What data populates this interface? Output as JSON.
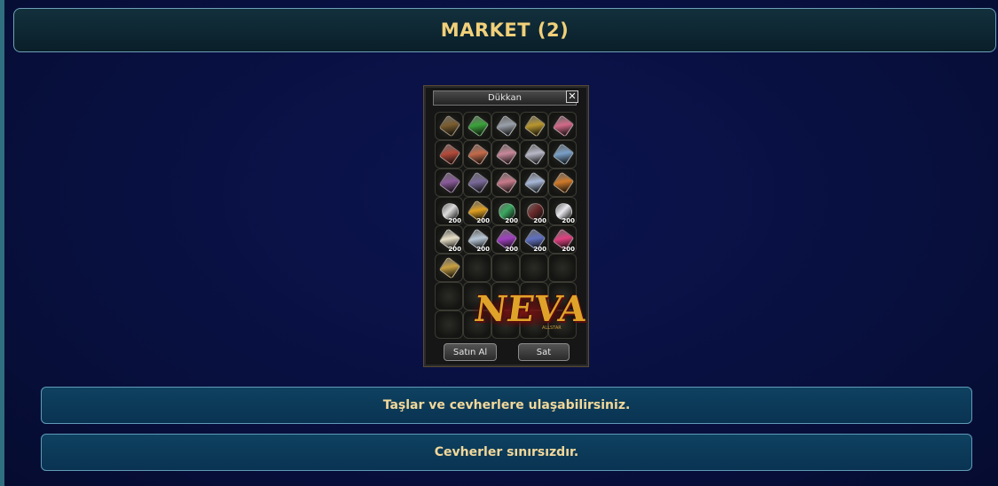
{
  "header": {
    "title": "MARKET (2)"
  },
  "shop": {
    "title": "Dükkan",
    "close_glyph": "✕",
    "slots": [
      {
        "icon": "wooden-plank-icon",
        "color": "#7a5c2e",
        "qty": ""
      },
      {
        "icon": "green-crystal-icon",
        "color": "#3aa23a",
        "qty": ""
      },
      {
        "icon": "silver-dagger-icon",
        "color": "#9aa0aa",
        "qty": ""
      },
      {
        "icon": "gold-ore-icon",
        "color": "#b8962e",
        "qty": ""
      },
      {
        "icon": "pink-crystal-icon",
        "color": "#d36a8a",
        "qty": ""
      },
      {
        "icon": "red-crystal-icon",
        "color": "#b44a3a",
        "qty": ""
      },
      {
        "icon": "orange-crystal-icon",
        "color": "#c56a4a",
        "qty": ""
      },
      {
        "icon": "pink-shard-icon",
        "color": "#c8889a",
        "qty": ""
      },
      {
        "icon": "silver-shard-icon",
        "color": "#b8b8c8",
        "qty": ""
      },
      {
        "icon": "blue-crystal-icon",
        "color": "#7aa0c8",
        "qty": ""
      },
      {
        "icon": "purple-crystal-icon",
        "color": "#8a5a9a",
        "qty": ""
      },
      {
        "icon": "violet-crystal-icon",
        "color": "#7a6a9a",
        "qty": ""
      },
      {
        "icon": "rose-crystal-icon",
        "color": "#c87a8a",
        "qty": ""
      },
      {
        "icon": "ice-crystal-icon",
        "color": "#a8b8d8",
        "qty": ""
      },
      {
        "icon": "amber-crystal-icon",
        "color": "#d07a2a",
        "qty": ""
      },
      {
        "icon": "diamond-icon",
        "color": "#dcdcdc",
        "qty": "200",
        "round": true
      },
      {
        "icon": "gold-bar-icon",
        "color": "#e0a020",
        "qty": "200"
      },
      {
        "icon": "jade-stone-icon",
        "color": "#3aa860",
        "qty": "200",
        "round": true
      },
      {
        "icon": "dark-pearl-icon",
        "color": "#6a2a2a",
        "qty": "200",
        "round": true
      },
      {
        "icon": "white-pearl-icon",
        "color": "#e8e8ee",
        "qty": "200",
        "round": true
      },
      {
        "icon": "white-block-icon",
        "color": "#e8e0c8",
        "qty": "200"
      },
      {
        "icon": "clear-crystal-icon",
        "color": "#b8c8d8",
        "qty": "200"
      },
      {
        "icon": "amethyst-icon",
        "color": "#a040c0",
        "qty": "200"
      },
      {
        "icon": "sapphire-icon",
        "color": "#6070c0",
        "qty": "200"
      },
      {
        "icon": "ruby-icon",
        "color": "#e04080",
        "qty": "200"
      },
      {
        "icon": "golden-spike-icon",
        "color": "#c8a040",
        "qty": ""
      }
    ],
    "buy_label": "Satın Al",
    "sell_label": "Sat",
    "logo": {
      "text": "NEVA",
      "subtext": "ALLSTAR"
    }
  },
  "info_boxes": [
    {
      "text": "Taşlar ve cevherlere ulaşabilirsiniz."
    },
    {
      "text": "Cevherler sınırsızdır."
    }
  ]
}
